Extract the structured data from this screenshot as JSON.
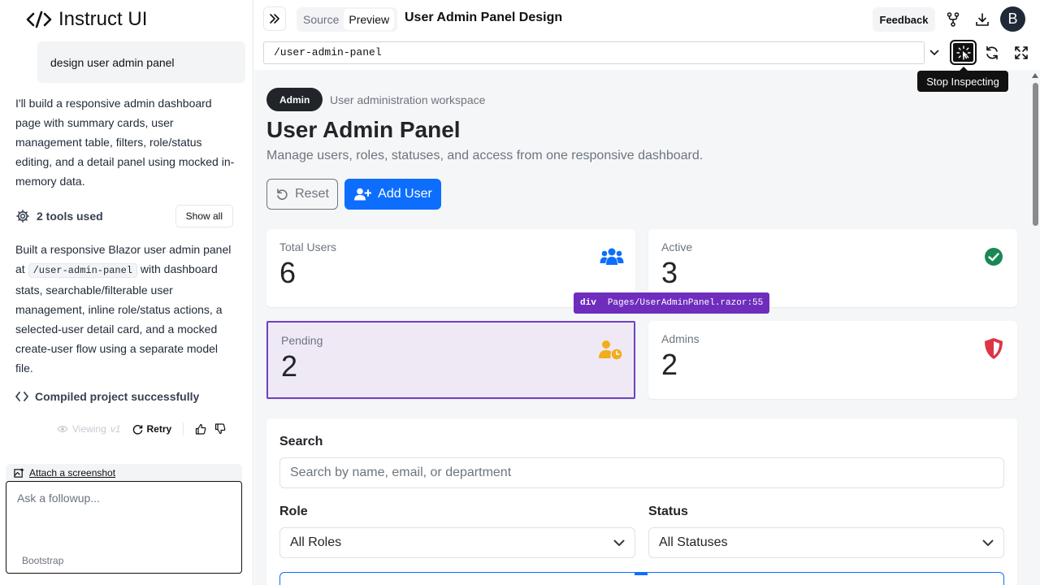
{
  "app": {
    "logo_text": "Instruct UI",
    "user_message": "design user admin panel",
    "assistant_intro": "I'll build a responsive admin dashboard page with summary cards, user management table, filters, role/status editing, and a detail panel using mocked in-memory data.",
    "tools_used_label": "2 tools used",
    "show_all_label": "Show all",
    "summary_before": "Built a responsive Blazor user admin panel at",
    "summary_code": "/user-admin-panel",
    "summary_after": "with dashboard stats, searchable/filterable user management, inline role/status actions, a selected-user detail card, and a mocked create-user flow using a separate model file.",
    "compiled_label": "Compiled project successfully",
    "viewing_label": "Viewing",
    "viewing_version": "v1",
    "retry_label": "Retry",
    "attach_label": "Attach a screenshot",
    "followup_placeholder": "Ask a followup...",
    "framework_label": "Bootstrap"
  },
  "topbar": {
    "source_tab": "Source",
    "preview_tab": "Preview",
    "title": "User Admin Panel Design",
    "feedback_label": "Feedback",
    "avatar_initial": "B"
  },
  "url_bar": {
    "value": "/user-admin-panel",
    "tooltip": "Stop Inspecting"
  },
  "preview": {
    "badge": "Admin",
    "badge_sub": "User administration workspace",
    "heading": "User Admin Panel",
    "lead": "Manage users, roles, statuses, and access from one responsive dashboard.",
    "reset_label": "Reset",
    "add_user_label": "Add User",
    "stats": [
      {
        "label": "Total Users",
        "value": "6",
        "icon": "users-icon",
        "color": "#0d6efd"
      },
      {
        "label": "Active",
        "value": "3",
        "icon": "check-circle-icon",
        "color": "#198754"
      },
      {
        "label": "Pending",
        "value": "2",
        "icon": "user-clock-icon",
        "color": "#ffc107"
      },
      {
        "label": "Admins",
        "value": "2",
        "icon": "shield-icon",
        "color": "#dc3545"
      }
    ],
    "inspector_tag": {
      "element": "div",
      "source": "Pages/UserAdminPanel.razor:55"
    },
    "filters": {
      "search_label": "Search",
      "search_placeholder": "Search by name, email, or department",
      "role_label": "Role",
      "role_value": "All Roles",
      "status_label": "Status",
      "status_value": "All Statuses"
    }
  },
  "colors": {
    "primary": "#0d6efd",
    "inspect_highlight": "#6f42c1",
    "dark": "#212529"
  }
}
